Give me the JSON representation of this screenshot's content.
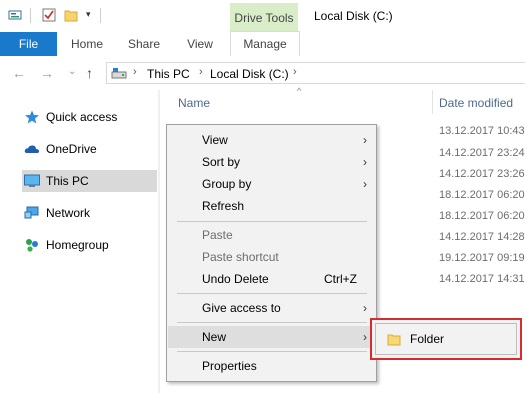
{
  "window": {
    "title": "Local Disk (C:)",
    "contextual_tab_group": "Drive Tools",
    "accent_color": "#1979ca"
  },
  "ribbon": {
    "tabs": [
      "File",
      "Home",
      "Share",
      "View",
      "Manage"
    ]
  },
  "address": {
    "breadcrumbs": [
      "This PC",
      "Local Disk (C:)"
    ]
  },
  "sidebar": {
    "items": [
      {
        "label": "Quick access",
        "icon": "star-icon"
      },
      {
        "label": "OneDrive",
        "icon": "cloud-icon"
      },
      {
        "label": "This PC",
        "icon": "computer-icon",
        "selected": true
      },
      {
        "label": "Network",
        "icon": "network-icon"
      },
      {
        "label": "Homegroup",
        "icon": "homegroup-icon"
      }
    ]
  },
  "file_list": {
    "columns": [
      "Name",
      "Date modified"
    ],
    "dates": [
      "13.12.2017 10:43",
      "14.12.2017 23:24",
      "14.12.2017 23:26",
      "18.12.2017 06:20",
      "18.12.2017 06:20",
      "14.12.2017 14:28",
      "19.12.2017 09:19",
      "14.12.2017 14:31"
    ]
  },
  "context_menu": {
    "items": [
      {
        "label": "View",
        "submenu": true
      },
      {
        "label": "Sort by",
        "submenu": true
      },
      {
        "label": "Group by",
        "submenu": true
      },
      {
        "label": "Refresh"
      },
      {
        "label": "Paste",
        "disabled": true
      },
      {
        "label": "Paste shortcut",
        "disabled": true
      },
      {
        "label": "Undo Delete",
        "shortcut": "Ctrl+Z"
      },
      {
        "label": "Give access to",
        "submenu": true
      },
      {
        "label": "New",
        "submenu": true,
        "highlighted": true
      },
      {
        "label": "Properties"
      }
    ]
  },
  "new_submenu": {
    "items": [
      {
        "label": "Folder",
        "icon": "folder-icon"
      }
    ],
    "highlight_color": "#d52d2d"
  }
}
